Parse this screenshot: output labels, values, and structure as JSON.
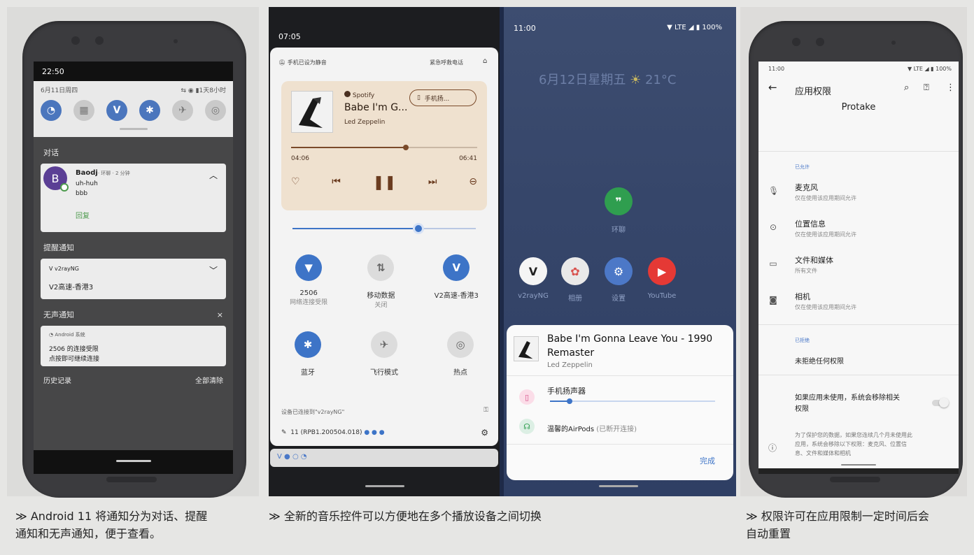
{
  "p1": {
    "time": "22:50",
    "date": "6月11日周四",
    "battery": "1天8小时",
    "conv_title": "对话",
    "conv_avatar": "B",
    "conv_name": "Baodj",
    "conv_meta": "· 环聊 · 2 分钟",
    "conv_line1": "uh-huh",
    "conv_line2": "bbb",
    "conv_reply": "回复",
    "alert_title": "提醒通知",
    "alert_app": "v2rayNG",
    "alert_body": "V2高速-香港3",
    "silent_title": "无声通知",
    "silent_close": "×",
    "silent_app": "Android 系统",
    "silent_line1": "2506 的连接受限",
    "silent_line2": "点按即可继续连接",
    "history": "历史记录",
    "clear_all": "全部清除"
  },
  "p2": {
    "time": "07:05",
    "muted": "手机已设为静音",
    "emergency": "紧急呼救电话",
    "spotify": "Spotify",
    "song": "Babe I'm G...",
    "artist": "Led Zeppelin",
    "output_chip": "手机扬...",
    "pos": "04:06",
    "dur": "06:41",
    "tiles_row1": [
      {
        "label": "2506",
        "sub": "网络连接受限"
      },
      {
        "label": "移动数据",
        "sub": "关闭"
      },
      {
        "label": "V2高速-香港3",
        "sub": ""
      }
    ],
    "tiles_row2": [
      {
        "label": "蓝牙",
        "sub": ""
      },
      {
        "label": "飞行模式",
        "sub": ""
      },
      {
        "label": "热点",
        "sub": ""
      }
    ],
    "vpn": "设备已连接到\"v2rayNG\"",
    "build": "11 (RPB1.200504.018)",
    "home_time": "11:00",
    "home_battery": "100%",
    "home_date": "6月12日星期五",
    "home_weather": "21°C",
    "home_apps": [
      "v2rayNG",
      "相册",
      "设置",
      "YouTube"
    ],
    "home_app_single": "环聊",
    "sheet_song": "Babe I'm Gonna Leave You - 1990 Remaster",
    "sheet_artist": "Led Zeppelin",
    "sheet_speaker": "手机扬声器",
    "sheet_airpods": "温馨的AirPods",
    "sheet_airpods_state": "(已断开连接)",
    "sheet_done": "完成"
  },
  "p3": {
    "time": "11:00",
    "battery": "100%",
    "title": "应用权限",
    "app": "Protake",
    "allowed_header": "已允许",
    "perms": [
      {
        "title": "麦克风",
        "sub": "仅在使用该应用期间允许"
      },
      {
        "title": "位置信息",
        "sub": "仅在使用该应用期间允许"
      },
      {
        "title": "文件和媒体",
        "sub": "所有文件"
      },
      {
        "title": "相机",
        "sub": "仅在使用该应用期间允许"
      }
    ],
    "denied_header": "已拒绝",
    "denied_none": "未拒绝任何权限",
    "auto_reset_1": "如果应用未使用，系统会移除相关",
    "auto_reset_2": "权限",
    "info_1": "为了保护您的数据，如果您连续几个月未使用此",
    "info_2": "应用，系统会移除以下权限：麦克风、位置信",
    "info_3": "息、文件和媒体和相机"
  },
  "captions": {
    "c1_1": "≫ Android 11 将通知分为对话、提醒",
    "c1_2": "通知和无声通知，便于查看。",
    "c2": "≫ 全新的音乐控件可以方便地在多个播放设备之间切换",
    "c3_1": "≫ 权限许可在应用限制一定时间后会",
    "c3_2": "自动重置"
  },
  "colors": {
    "accent_blue": "#4b76bd",
    "media_bg": "#efe1cf",
    "media_accent": "#7a4a2a",
    "link_green": "#4c9a4c",
    "sheet_blue": "#3d74c7"
  }
}
